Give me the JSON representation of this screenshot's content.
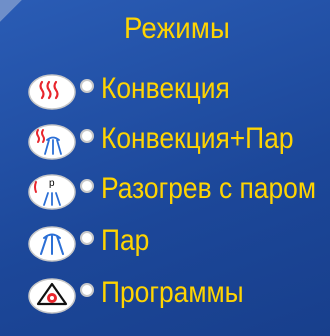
{
  "header": {
    "title": "Режимы"
  },
  "modes": [
    {
      "label": "Конвекция",
      "icon": "convection-icon"
    },
    {
      "label": "Конвекция+Пар",
      "icon": "convection-steam-icon"
    },
    {
      "label": "Разогрев с паром",
      "icon": "preheat-steam-icon"
    },
    {
      "label": "Пар",
      "icon": "steam-icon"
    },
    {
      "label": "Программы",
      "icon": "programs-icon"
    }
  ],
  "colors": {
    "background": "#1f4fa3",
    "text": "#ffd400",
    "heat_red": "#e8262d",
    "steam_blue": "#2b6fd6"
  }
}
